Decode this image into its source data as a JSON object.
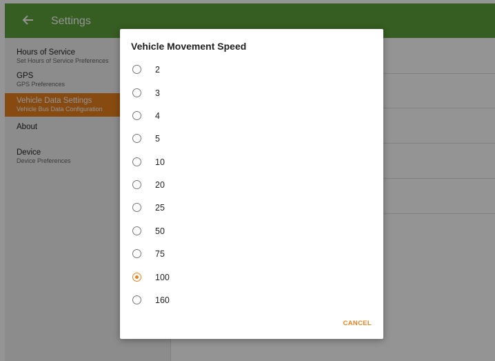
{
  "app": {
    "title": "Settings"
  },
  "sidebar": {
    "items": [
      {
        "label": "Hours of Service",
        "sub": "Set Hours of Service Preferences"
      },
      {
        "label": "GPS",
        "sub": "GPS Preferences"
      },
      {
        "label": "Vehicle Data Settings",
        "sub": "Vehicle Bus Data Configuration"
      },
      {
        "label": "About",
        "sub": ""
      },
      {
        "label": "Device",
        "sub": "Device Preferences"
      }
    ]
  },
  "dialog": {
    "title": "Vehicle Movement Speed",
    "options": [
      "2",
      "3",
      "4",
      "5",
      "10",
      "20",
      "25",
      "50",
      "75",
      "100",
      "160"
    ],
    "selected": "100",
    "cancel_label": "CANCEL"
  },
  "colors": {
    "header": "#5ea13b",
    "accent": "#e8821e"
  }
}
